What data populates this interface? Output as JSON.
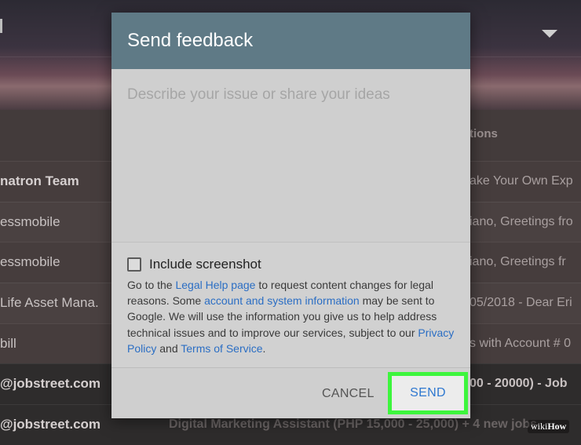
{
  "background": {
    "column_header": "tions",
    "rows": [
      {
        "sender": "natron Team",
        "subject": "ake Your Own Exp",
        "bold": true
      },
      {
        "sender": "essmobile",
        "subject": "iano, Greetings fro",
        "bold": false
      },
      {
        "sender": "essmobile",
        "subject": "iano, Greetings fr",
        "bold": false
      },
      {
        "sender": "Life Asset Mana.",
        "subject": "05/2018 - Dear Eri",
        "bold": false
      },
      {
        "sender": "bill",
        "subject": "s with Account # 0",
        "bold": false
      },
      {
        "sender": "@jobstreet.com",
        "subject": "00 - 20000) - Job",
        "bold": true
      },
      {
        "sender": "@jobstreet.com",
        "subject": "Digital Marketing Assistant (PHP 15,000 - 25,000) + 4 new jobs",
        "bold": true
      }
    ]
  },
  "dialog": {
    "title": "Send feedback",
    "textarea_placeholder": "Describe your issue or share your ideas",
    "checkbox_label": "Include screenshot",
    "legal": {
      "t1": "Go to the ",
      "link1": "Legal Help page",
      "t2": " to request content changes for legal reasons. Some ",
      "link2": "account and system information",
      "t3": " may be sent to Google. We will use the information you give us to help address technical issues and to improve our services, subject to our ",
      "link3": "Privacy Policy",
      "t4": " and ",
      "link4": "Terms of Service",
      "t5": "."
    },
    "cancel_label": "CANCEL",
    "send_label": "SEND"
  },
  "watermark": {
    "wiki": "wiki",
    "how": "How"
  },
  "colors": {
    "header": "#5f7a86",
    "link": "#2b6ec4",
    "send_text": "#2f78d0",
    "highlight": "#3df53d"
  }
}
